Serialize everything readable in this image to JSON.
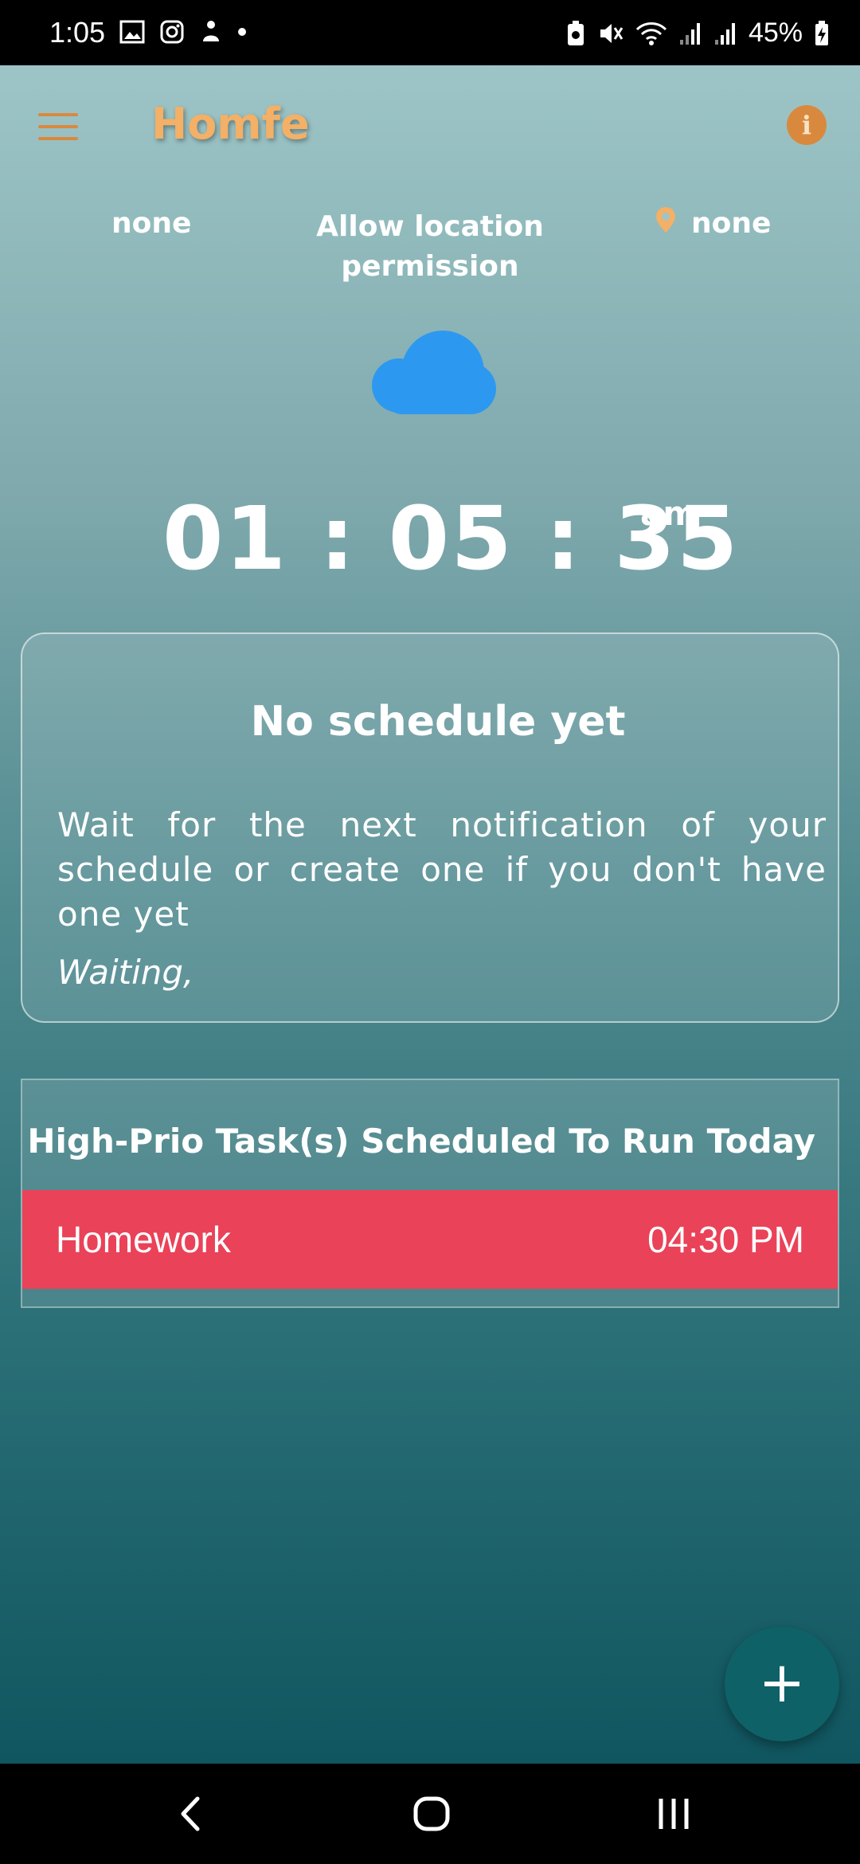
{
  "status_bar": {
    "time": "1:05",
    "battery_pct": "45%"
  },
  "header": {
    "title": "Homfe",
    "menu_icon": "hamburger-menu-icon",
    "info_icon": "info-icon",
    "info_glyph": "i"
  },
  "location": {
    "left": "none",
    "center": "Allow location permission",
    "right": "none",
    "pin_icon": "location-pin-icon"
  },
  "weather": {
    "icon": "cloud-icon",
    "color": "#2d98f0"
  },
  "clock": {
    "time": "01 : 05 : 35",
    "ampm": "am"
  },
  "schedule_card": {
    "title": "No schedule yet",
    "message": "Wait for the next notification of your schedule or create one if you don't have one yet",
    "status": "Waiting,"
  },
  "tasks": {
    "title": "High-Prio Task(s) Scheduled To Run Today",
    "items": [
      {
        "name": "Homework",
        "time": "04:30 PM"
      }
    ]
  },
  "fab": {
    "label": "+"
  },
  "colors": {
    "accent": "#d9893e",
    "title": "#f3b066",
    "task_bar": "#ea4258",
    "fab": "#0f6168"
  }
}
